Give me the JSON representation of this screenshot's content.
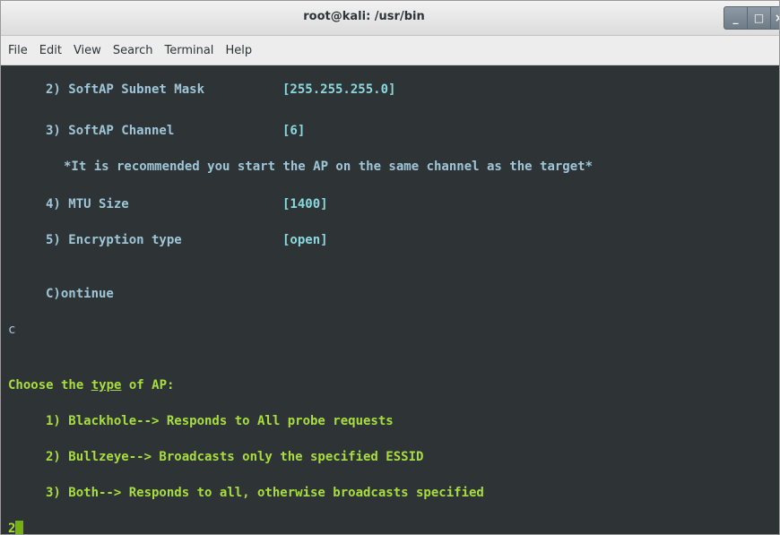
{
  "window": {
    "title": "root@kali: /usr/bin",
    "min_glyph": "_",
    "max_glyph": "□",
    "close_glyph": "×"
  },
  "menu": [
    "File",
    "Edit",
    "View",
    "Search",
    "Terminal",
    "Help"
  ],
  "terminal": {
    "opt2_label": "2) SoftAP Subnet Mask",
    "opt2_value": "[255.255.255.0]",
    "opt3_label": "3) SoftAP Channel",
    "opt3_value": "[6]",
    "note": "*It is recommended you start the AP on the same channel as the target*",
    "opt4_label": "4) MTU Size",
    "opt4_value": "[1400]",
    "opt5_label": "5) Encryption type",
    "opt5_value": "[open]",
    "continue": "C)ontinue",
    "input_c": "c",
    "choose_prefix": "Choose the ",
    "choose_type": "type",
    "choose_suffix": " of AP:",
    "ap1": "1) Blackhole--> Responds to All probe requests",
    "ap2": "2) Bullzeye--> Broadcasts only the specified ESSID",
    "ap3": "3) Both--> Responds to all, otherwise broadcasts specified",
    "input_2": "2"
  },
  "colors": {
    "terminal_bg": "#2e3436",
    "option_text": "#9fc6d8",
    "value_text": "#8ad9df",
    "prompt_green": "#a8dd3f",
    "cursor": "#74b00e"
  }
}
